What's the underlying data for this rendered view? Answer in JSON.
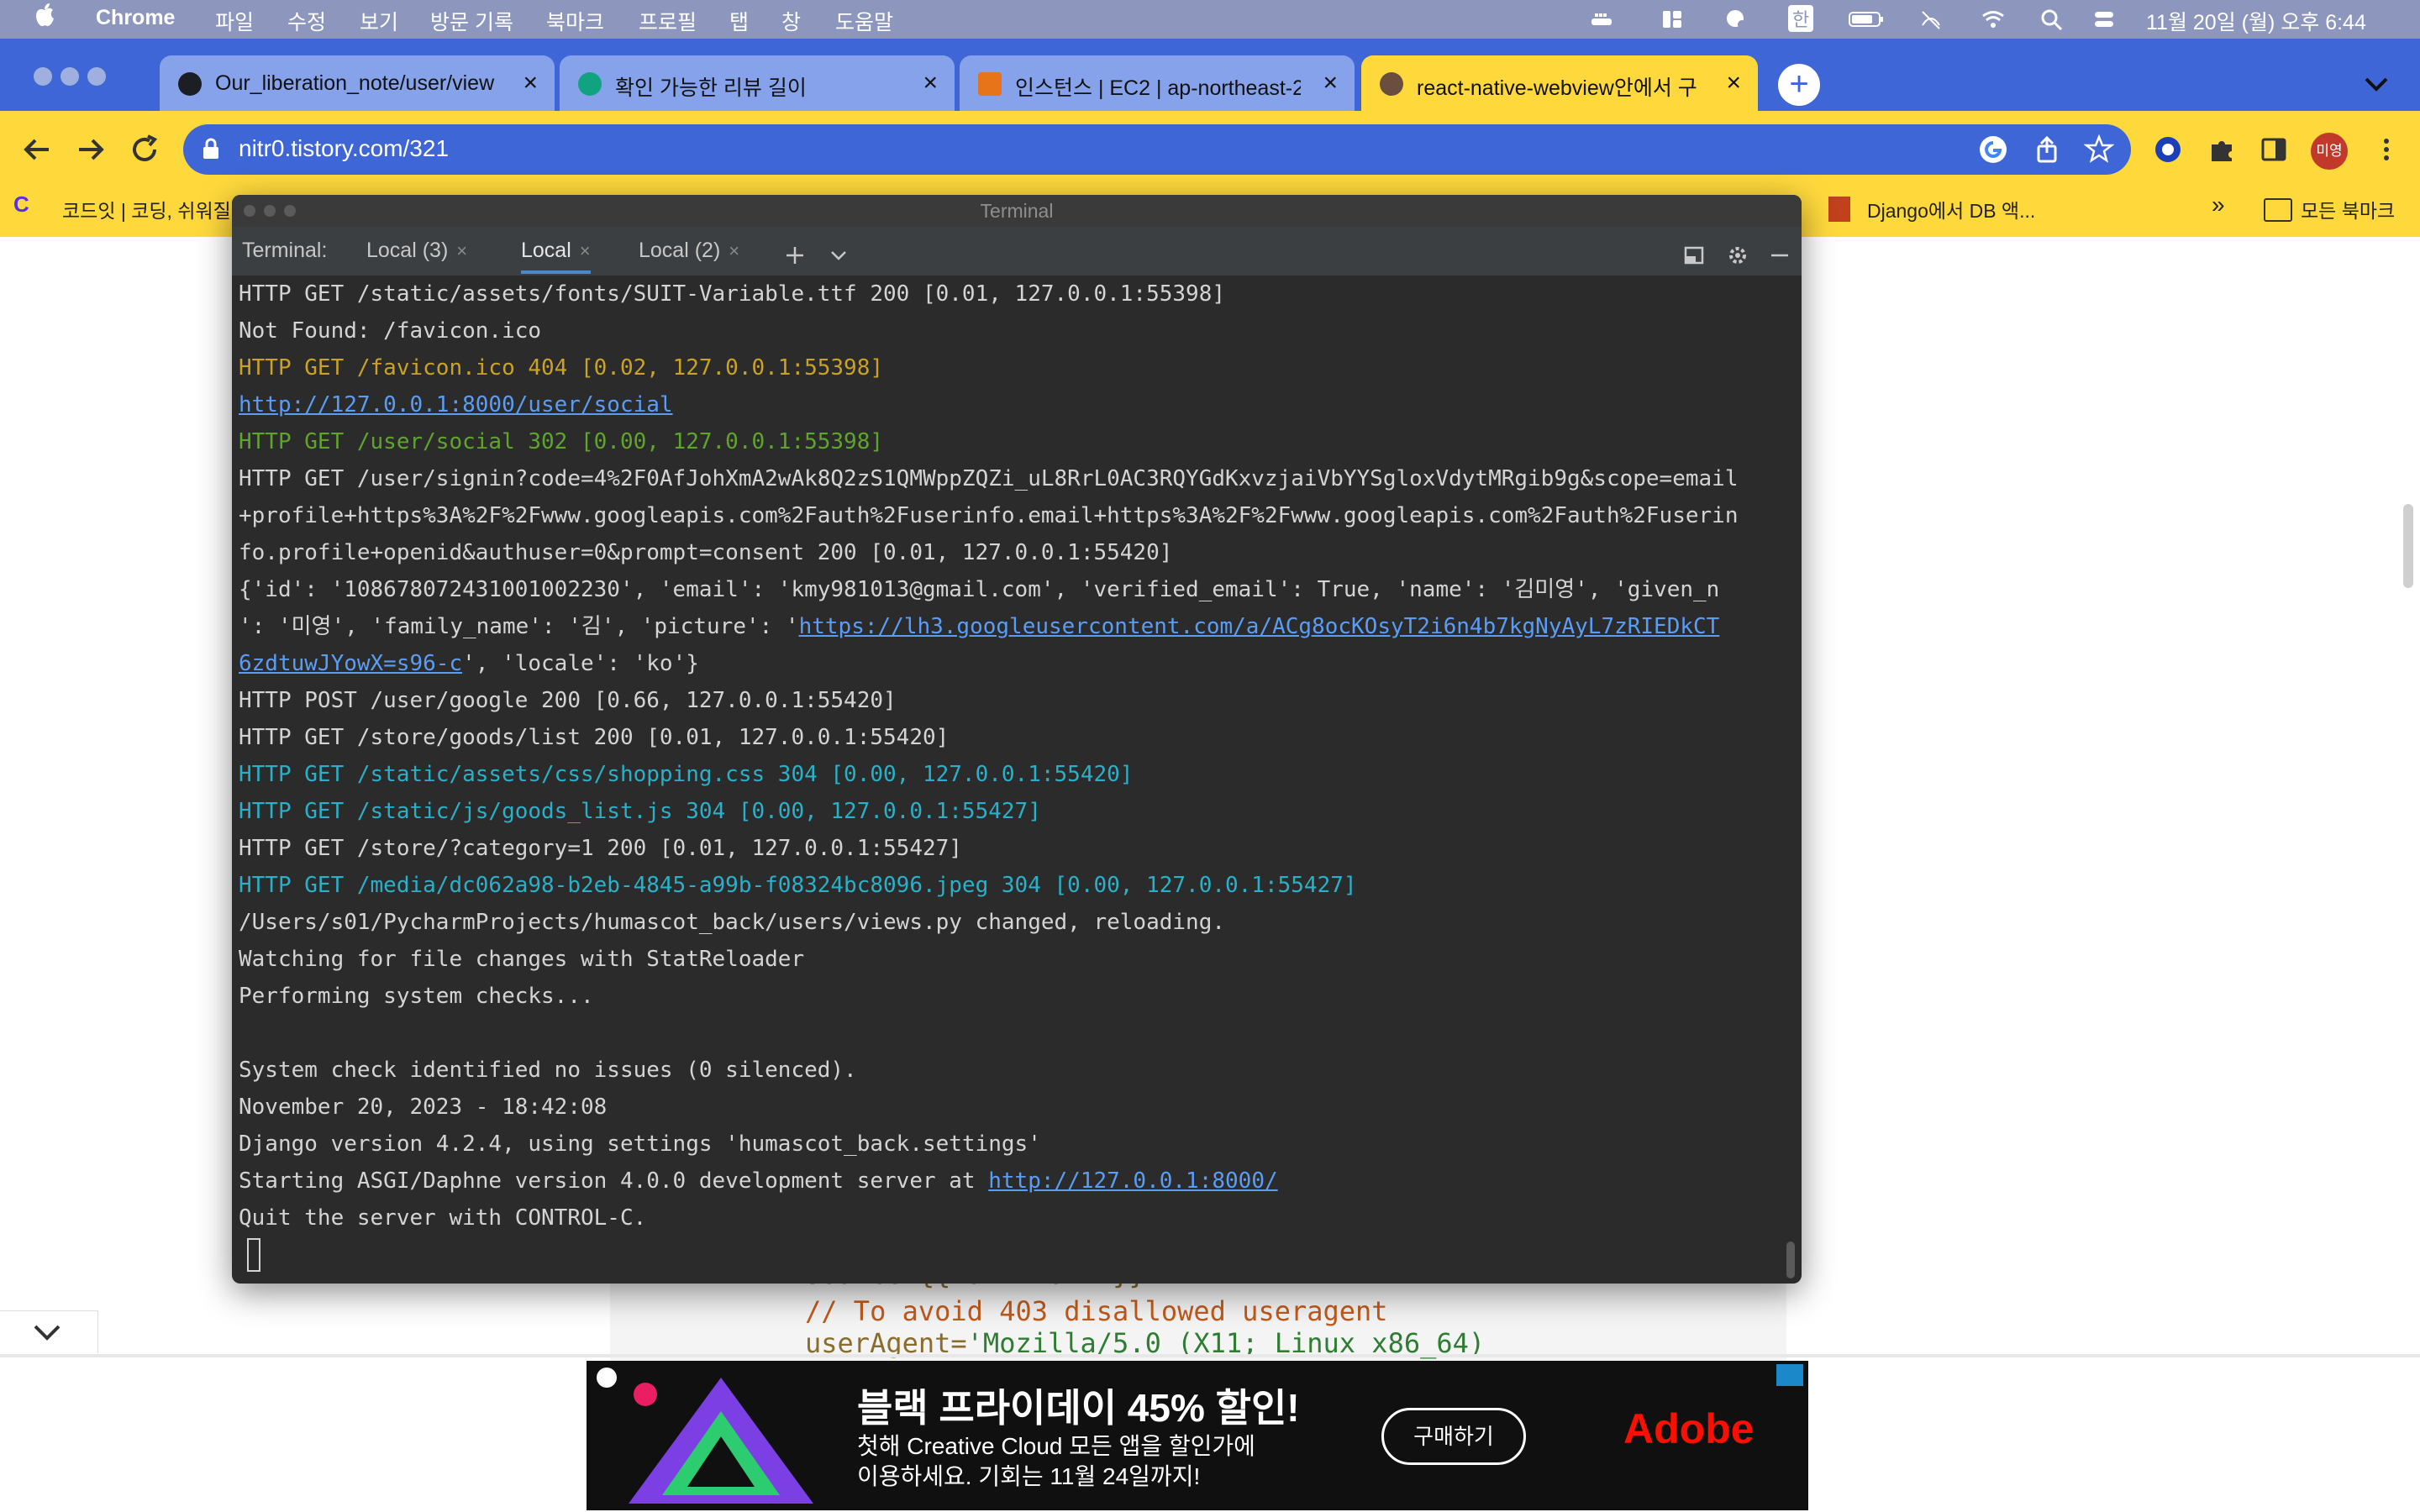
{
  "menubar": {
    "app_name": "Chrome",
    "items": [
      "파일",
      "수정",
      "보기",
      "방문 기록",
      "북마크",
      "프로필",
      "탭",
      "창",
      "도움말"
    ],
    "clock": "11월 20일 (월) 오후 6:44",
    "ime": "한"
  },
  "browser": {
    "tabs": [
      {
        "title": "Our_liberation_note/user/view",
        "icon": "github-icon",
        "active": false
      },
      {
        "title": "확인 가능한 리뷰 길이",
        "icon": "openai-icon",
        "active": false
      },
      {
        "title": "인스턴스 | EC2 | ap-northeast-2",
        "icon": "aws-icon",
        "active": false
      },
      {
        "title": "react-native-webview안에서 구",
        "icon": "blog-avatar-icon",
        "active": true
      }
    ],
    "url": "nitr0.tistory.com/321",
    "profile_initials": "미영",
    "bookmarks": {
      "left": "코드잇 | 코딩, 쉬워질",
      "right": "Django에서 DB 액...",
      "overflow": "»",
      "all_bookmarks": "모든 북마크"
    }
  },
  "terminal": {
    "window_title": "Terminal",
    "label": "Terminal:",
    "tabs": [
      {
        "label": "Local (3)",
        "selected": false
      },
      {
        "label": "Local",
        "selected": true
      },
      {
        "label": "Local (2)",
        "selected": false
      }
    ],
    "lines": [
      [
        {
          "t": "HTTP GET /static/assets/fonts/SUIT-Variable.ttf 200 [0.01, 127.0.0.1:55398]",
          "c": "white"
        }
      ],
      [
        {
          "t": "Not Found: /favicon.ico",
          "c": "white"
        }
      ],
      [
        {
          "t": "HTTP GET /favicon.ico 404 [0.02, 127.0.0.1:55398]",
          "c": "yellow"
        }
      ],
      [
        {
          "t": "http://127.0.0.1:8000/user/social",
          "c": "link"
        }
      ],
      [
        {
          "t": "HTTP GET /user/social 302 [0.00, 127.0.0.1:55398]",
          "c": "green"
        }
      ],
      [
        {
          "t": "HTTP GET /user/signin?code=4%2F0AfJohXmA2wAk8Q2zS1QMWppZQZi_uL8RrL0AC3RQYGdKxvzjaiVbYYSgloxVdytMRgib9g&scope=email",
          "c": "white"
        }
      ],
      [
        {
          "t": "+profile+https%3A%2F%2Fwww.googleapis.com%2Fauth%2Fuserinfo.email+https%3A%2F%2Fwww.googleapis.com%2Fauth%2Fuserin",
          "c": "white"
        }
      ],
      [
        {
          "t": "fo.profile+openid&authuser=0&prompt=consent 200 [0.01, 127.0.0.1:55420]",
          "c": "white"
        }
      ],
      [
        {
          "t": "{'id': '108678072431001002230', 'email': 'kmy981013@gmail.com', 'verified_email': True, 'name': '김미영', 'given_n",
          "c": "white"
        }
      ],
      [
        {
          "t": "': '미영', 'family_name': '김', 'picture': '",
          "c": "white"
        },
        {
          "t": "https://lh3.googleusercontent.com/a/ACg8ocKOsyT2i6n4b7kgNyAyL7zRIEDkCT",
          "c": "link"
        }
      ],
      [
        {
          "t": "6zdtuwJYowX=s96-c",
          "c": "link"
        },
        {
          "t": "', 'locale': 'ko'}",
          "c": "white"
        }
      ],
      [
        {
          "t": "HTTP POST /user/google 200 [0.66, 127.0.0.1:55420]",
          "c": "white"
        }
      ],
      [
        {
          "t": "HTTP GET /store/goods/list 200 [0.01, 127.0.0.1:55420]",
          "c": "white"
        }
      ],
      [
        {
          "t": "HTTP GET /static/assets/css/shopping.css 304 [0.00, 127.0.0.1:55420]",
          "c": "cyan"
        }
      ],
      [
        {
          "t": "HTTP GET /static/js/goods_list.js 304 [0.00, 127.0.0.1:55427]",
          "c": "cyan"
        }
      ],
      [
        {
          "t": "HTTP GET /store/?category=1 200 [0.01, 127.0.0.1:55427]",
          "c": "white"
        }
      ],
      [
        {
          "t": "HTTP GET /media/dc062a98-b2eb-4845-a99b-f08324bc8096.jpeg 304 [0.00, 127.0.0.1:55427]",
          "c": "cyan"
        }
      ],
      [
        {
          "t": "/Users/s01/PycharmProjects/humascot_back/users/views.py changed, reloading.",
          "c": "white"
        }
      ],
      [
        {
          "t": "Watching for file changes with StatReloader",
          "c": "white"
        }
      ],
      [
        {
          "t": "Performing system checks...",
          "c": "white"
        }
      ],
      [
        {
          "t": "",
          "c": "white"
        }
      ],
      [
        {
          "t": "System check identified no issues (0 silenced).",
          "c": "white"
        }
      ],
      [
        {
          "t": "November 20, 2023 - 18:42:08",
          "c": "white"
        }
      ],
      [
        {
          "t": "Django version 4.2.4, using settings 'humascot_back.settings'",
          "c": "white"
        }
      ],
      [
        {
          "t": "Starting ASGI/Daphne version 4.0.0 development server at ",
          "c": "white"
        },
        {
          "t": "http://127.0.0.1:8000/",
          "c": "link"
        }
      ],
      [
        {
          "t": "Quit the server with CONTROL-C.",
          "c": "white"
        }
      ]
    ]
  },
  "page": {
    "code_line1": "source={{ uri: URL }}",
    "code_line2_comment": "// To avoid 403 disallowed useragent",
    "code_line3_key": "userAgent=",
    "code_line3_value": "'Mozilla/5.0 (X11; Linux x86_64)"
  },
  "ad": {
    "headline": "블랙 프라이데이 45% 할인!",
    "sub_line1": "첫해 Creative Cloud 모든 앱을 할인가에",
    "sub_line2": "이용하세요. 기회는 11월 24일까지!",
    "cta": "구매하기",
    "brand": "Adobe"
  },
  "colors": {
    "menubar": "#8d97bd",
    "tabstrip": "#3e66d6",
    "toolbar": "#ffd93c",
    "terminal_bg": "#2b2b2b"
  }
}
